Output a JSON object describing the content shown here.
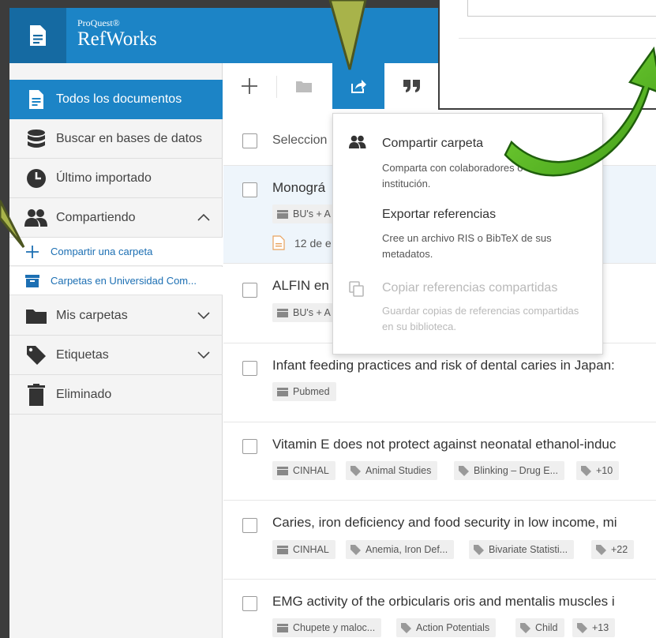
{
  "brand": {
    "small": "ProQuest®",
    "name": "RefWorks"
  },
  "sidebar": {
    "items": [
      {
        "label": "Todos los documentos"
      },
      {
        "label": "Buscar en bases de datos"
      },
      {
        "label": "Último importado"
      },
      {
        "label": "Compartiendo"
      },
      {
        "label": "Compartir una carpeta"
      },
      {
        "label": "Carpetas en Universidad Com..."
      },
      {
        "label": "Mis carpetas"
      },
      {
        "label": "Etiquetas"
      },
      {
        "label": "Eliminado"
      }
    ]
  },
  "toolbar": {
    "buttons": [
      "add-icon",
      "folder-icon",
      "share-icon",
      "quote-icon"
    ]
  },
  "list": {
    "select_label": "Seleccion",
    "rows": [
      {
        "title": "Monográ",
        "tags": [
          "BU's + A"
        ],
        "date": "12 de e"
      },
      {
        "title": "ALFIN en",
        "tags": [
          "BU's + A"
        ]
      },
      {
        "title": "Infant feeding practices and risk of dental caries in Japan:",
        "tags": [
          "Pubmed"
        ]
      },
      {
        "title": "Vitamin E does not protect against neonatal ethanol-induc",
        "tags": [
          "CINHAL",
          "Animal Studies",
          "Blinking – Drug E...",
          "+10"
        ]
      },
      {
        "title": "Caries, iron deficiency and food security in low income, mi",
        "tags": [
          "CINHAL",
          "Anemia, Iron Def...",
          "Bivariate Statisti...",
          "+22"
        ]
      },
      {
        "title": "EMG activity of the orbicularis oris and mentalis muscles i",
        "tags": [
          "Chupete y maloc...",
          "Action Potentials",
          "Child",
          "+13"
        ]
      }
    ]
  },
  "share_menu": {
    "items": [
      {
        "title": "Compartir carpeta",
        "desc": "Comparta con colaboradores o con la institución."
      },
      {
        "title": "Exportar referencias",
        "desc": "Cree un archivo RIS o BibTeX de sus metadatos."
      },
      {
        "title": "Copiar referencias compartidas",
        "desc": "Guardar copias de referencias compartidas en su biblioteca."
      }
    ]
  },
  "colors": {
    "brand_blue": "#1c84c6",
    "arrow_green": "#5ec42a",
    "pointer_olive": "#a8b34a"
  }
}
